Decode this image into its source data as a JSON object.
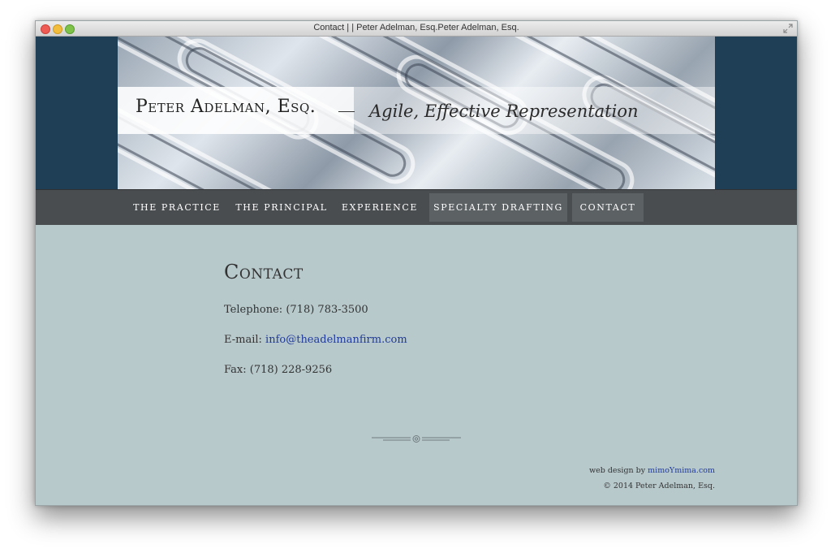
{
  "window": {
    "title": "Contact | | Peter Adelman, Esq.Peter Adelman, Esq."
  },
  "header": {
    "site_name": "Peter Adelman, Esq.",
    "tagline": "Agile, Effective Representation"
  },
  "nav": {
    "items": [
      {
        "label": "THE PRACTICE"
      },
      {
        "label": "THE PRINCIPAL"
      },
      {
        "label": "EXPERIENCE"
      },
      {
        "label": "SPECIALTY DRAFTING"
      },
      {
        "label": "CONTACT"
      }
    ]
  },
  "main": {
    "title": "Contact",
    "telephone_label": "Telephone:",
    "telephone_value": "(718) 783-3500",
    "email_label": "E-mail:",
    "email_value": "info@theadelmanfirm.com",
    "fax_label": "Fax:",
    "fax_value": "(718) 228-9256"
  },
  "footer": {
    "credit_prefix": "web design by",
    "credit_link": "mimoYmima.com",
    "copyright": "© 2014 Peter Adelman, Esq."
  },
  "colors": {
    "header_bg": "#1e3f55",
    "nav_bg": "#4a4d50",
    "content_bg": "#b8c9cc",
    "link": "#1f3a9a"
  }
}
